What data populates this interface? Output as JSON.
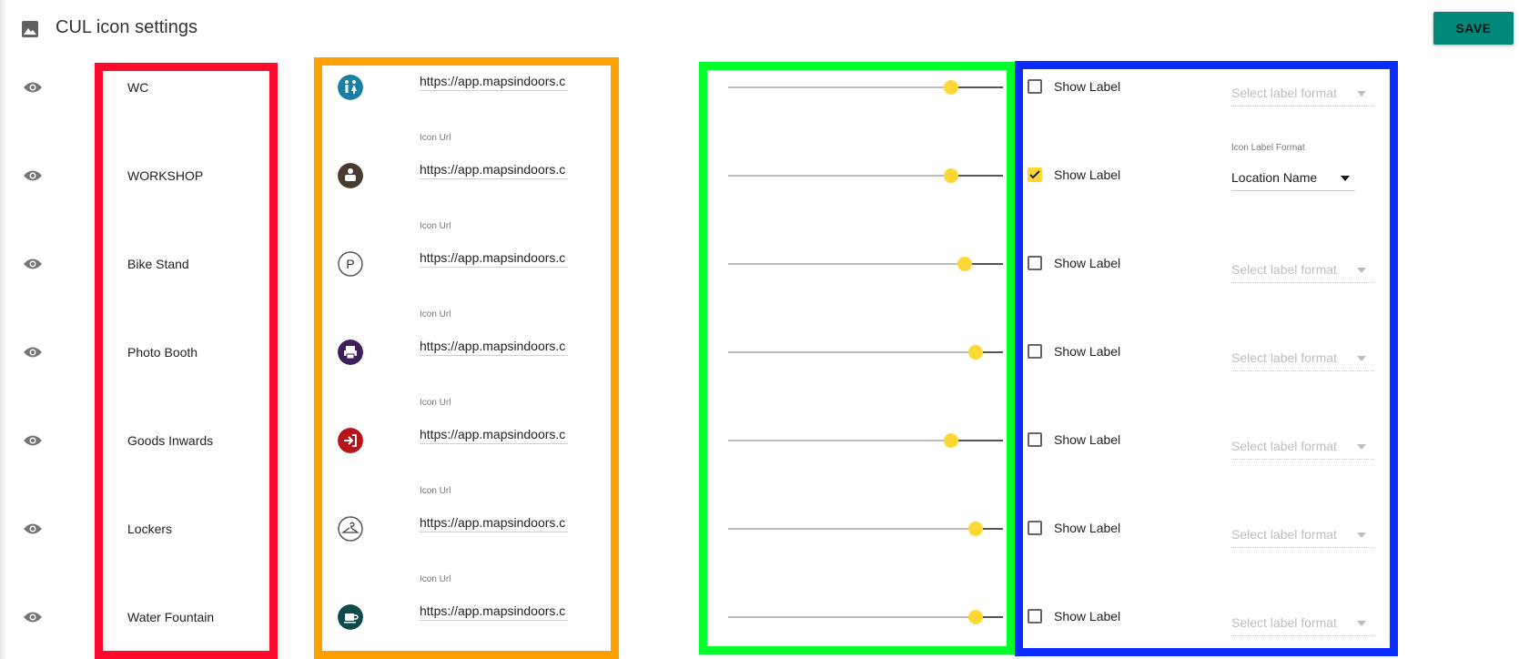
{
  "header": {
    "icon": "image-icon",
    "title": "CUL icon settings",
    "save_label": "SAVE"
  },
  "colors": {
    "save_button": "#00897b",
    "slider": "#fdd835",
    "frame_red": "#ff0a2a",
    "frame_orange": "#ff9f00",
    "frame_green": "#00ff2b",
    "frame_blue": "#0a2cff"
  },
  "rows": [
    {
      "name": "WC",
      "icon_label": "",
      "icon_url": "https://app.mapsindoors.c",
      "icon": "toilet-icon",
      "icon_color": "#1a7fa3",
      "slider": 0.81,
      "show_label": false,
      "format_label": "",
      "format_value": "Select label format"
    },
    {
      "name": "WORKSHOP",
      "icon_label": "Icon Url",
      "icon_url": "https://app.mapsindoors.c",
      "icon": "workshop-icon",
      "icon_color": "#4a3b32",
      "slider": 0.81,
      "show_label": true,
      "format_label": "Icon Label Format",
      "format_value": "Location Name"
    },
    {
      "name": "Bike Stand",
      "icon_label": "Icon Url",
      "icon_url": "https://app.mapsindoors.c",
      "icon": "parking-icon",
      "icon_color": "#ffffff",
      "slider": 0.86,
      "show_label": false,
      "format_label": "",
      "format_value": "Select label format"
    },
    {
      "name": "Photo Booth",
      "icon_label": "Icon Url",
      "icon_url": "https://app.mapsindoors.c",
      "icon": "printer-icon",
      "icon_color": "#3d1f5c",
      "slider": 0.9,
      "show_label": false,
      "format_label": "",
      "format_value": "Select label format"
    },
    {
      "name": "Goods Inwards",
      "icon_label": "Icon Url",
      "icon_url": "https://app.mapsindoors.c",
      "icon": "login-icon",
      "icon_color": "#b5141b",
      "slider": 0.81,
      "show_label": false,
      "format_label": "",
      "format_value": "Select label format"
    },
    {
      "name": "Lockers",
      "icon_label": "Icon Url",
      "icon_url": "https://app.mapsindoors.c",
      "icon": "hanger-icon",
      "icon_color": "#ffffff",
      "slider": 0.9,
      "show_label": false,
      "format_label": "",
      "format_value": "Select label format"
    },
    {
      "name": "Water Fountain",
      "icon_label": "Icon Url",
      "icon_url": "https://app.mapsindoors.c",
      "icon": "cup-icon",
      "icon_color": "#0e4a4a",
      "slider": 0.9,
      "show_label": false,
      "format_label": "",
      "format_value": "Select label format"
    }
  ],
  "show_label_text": "Show Label"
}
